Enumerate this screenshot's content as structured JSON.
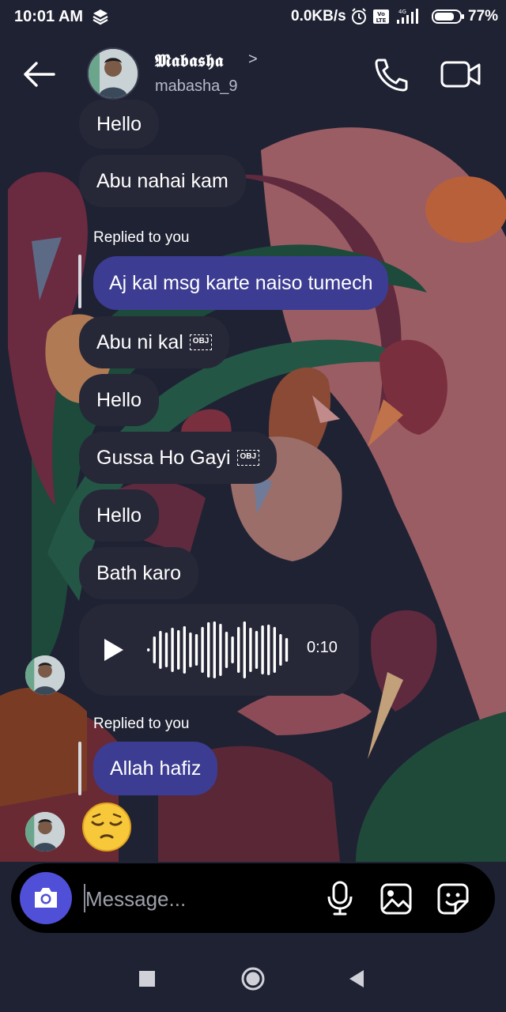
{
  "status_bar": {
    "time": "10:01 AM",
    "network_speed": "0.0KB/s",
    "battery": "77%",
    "icons": [
      "app-notification-icon",
      "alarm-icon",
      "volte-icon",
      "signal-icon",
      "battery-icon"
    ]
  },
  "header": {
    "display_name": "𝕸𝖆𝖇𝖆𝖘𝖍𝖆",
    "chevron": ">",
    "username": "mabasha_9"
  },
  "messages": {
    "m1": "Hello",
    "m2": "Abu nahai kam",
    "reply1_label": "Replied to you",
    "reply1_text": "Aj kal msg  karte naiso tumech",
    "m3": "Abu ni kal",
    "m3_obj": "OBJ",
    "m4": "Hello",
    "m5": "Gussa Ho Gayi",
    "m5_obj": "OBJ",
    "m6": "Hello",
    "m7": "Bath karo",
    "voice_duration": "0:10",
    "voice_progress": 0,
    "reply2_label": "Replied to you",
    "reply2_text": "Allah hafiz",
    "emoji": "pensive-face"
  },
  "composer": {
    "placeholder": "Message..."
  },
  "colors": {
    "background": "#1f2233",
    "received_bubble": "#262837",
    "sent_bubble": "#3c3c93",
    "camera_button": "#4f4fd8"
  }
}
